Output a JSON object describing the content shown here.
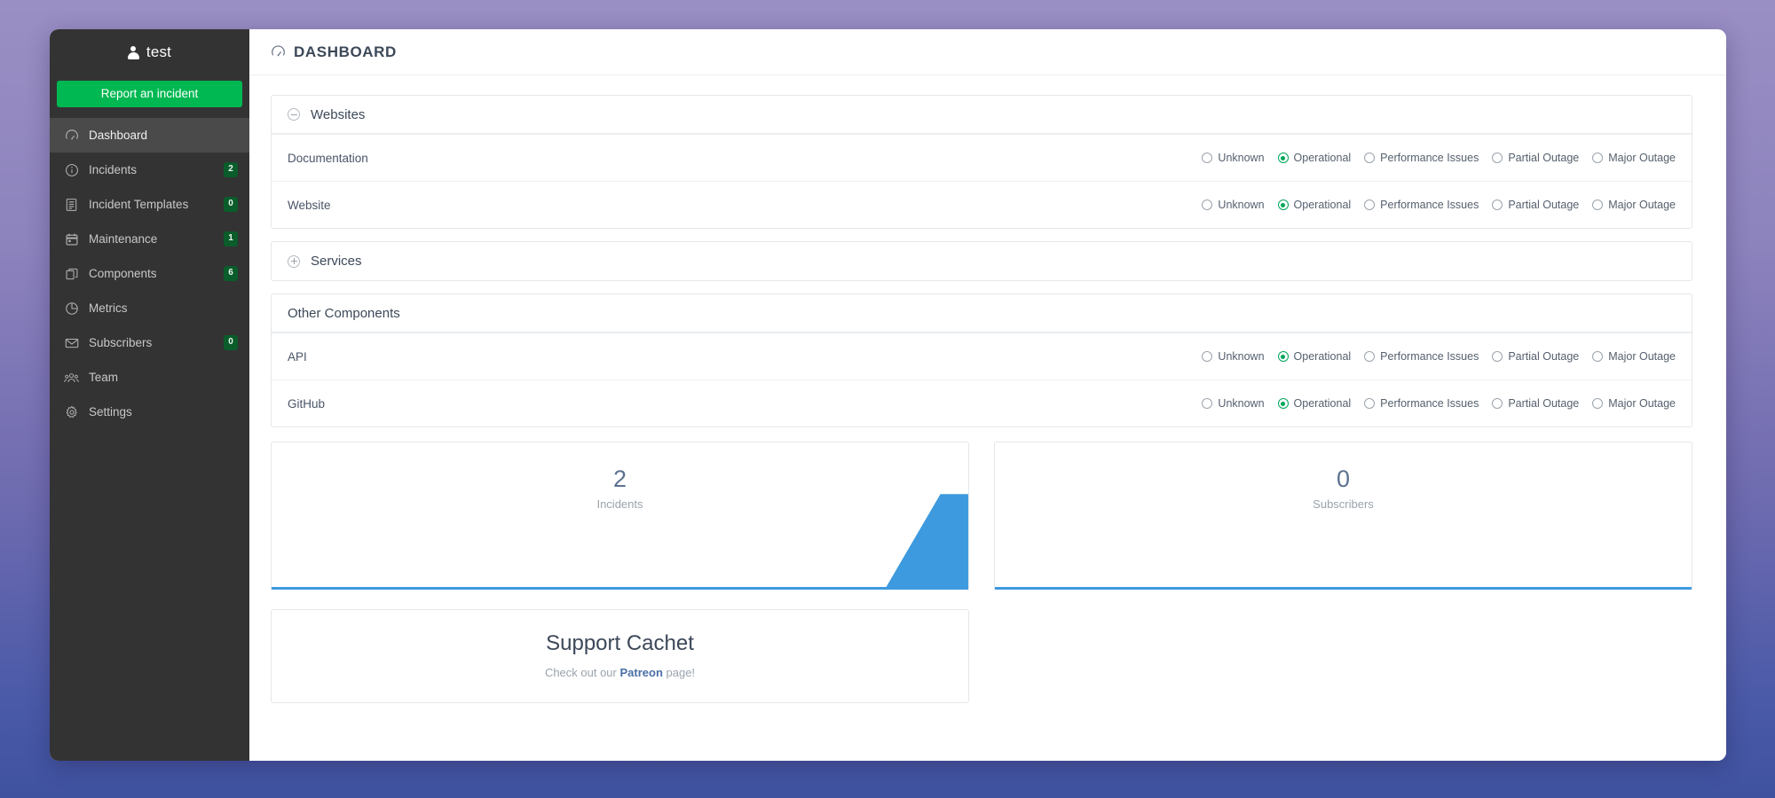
{
  "sidebar": {
    "brand": "test",
    "report_button": "Report an incident",
    "items": [
      {
        "label": "Dashboard",
        "icon": "dashboard-icon",
        "badge": null,
        "active": true
      },
      {
        "label": "Incidents",
        "icon": "info-circle-icon",
        "badge": "2",
        "active": false
      },
      {
        "label": "Incident Templates",
        "icon": "document-icon",
        "badge": "0",
        "active": false
      },
      {
        "label": "Maintenance",
        "icon": "calendar-icon",
        "badge": "1",
        "active": false
      },
      {
        "label": "Components",
        "icon": "copy-icon",
        "badge": "6",
        "active": false
      },
      {
        "label": "Metrics",
        "icon": "pie-chart-icon",
        "badge": null,
        "active": false
      },
      {
        "label": "Subscribers",
        "icon": "envelope-icon",
        "badge": "0",
        "active": false
      },
      {
        "label": "Team",
        "icon": "users-icon",
        "badge": null,
        "active": false
      },
      {
        "label": "Settings",
        "icon": "gear-icon",
        "badge": null,
        "active": false
      }
    ]
  },
  "topbar": {
    "icon": "dashboard-icon",
    "title": "DASHBOARD"
  },
  "status_options": [
    "Unknown",
    "Operational",
    "Performance Issues",
    "Partial Outage",
    "Major Outage"
  ],
  "groups": [
    {
      "name": "Websites",
      "toggle": "collapse",
      "collapsed": false,
      "components": [
        {
          "name": "Documentation",
          "status": "Operational"
        },
        {
          "name": "Website",
          "status": "Operational"
        }
      ]
    },
    {
      "name": "Services",
      "toggle": "expand",
      "collapsed": true,
      "components": []
    },
    {
      "name": "Other Components",
      "toggle": "none",
      "collapsed": false,
      "components": [
        {
          "name": "API",
          "status": "Operational"
        },
        {
          "name": "GitHub",
          "status": "Operational"
        }
      ]
    }
  ],
  "stats": [
    {
      "value": "2",
      "label": "Incidents",
      "accent": "#3e9ade",
      "spark": "spike-right"
    },
    {
      "value": "0",
      "label": "Subscribers",
      "accent": "#3e9ade",
      "spark": "flat"
    }
  ],
  "support": {
    "title": "Support Cachet",
    "text_before": "Check out our ",
    "link": "Patreon",
    "text_after": " page!"
  },
  "colors": {
    "sidebar_bg": "#333333",
    "sidebar_active": "#4a4a4a",
    "report_green": "#00b851",
    "badge_green": "#0a5c2a",
    "operational_green": "#00a65a",
    "chart_blue": "#3e9ade",
    "page_bg_top": "#9a8fc4",
    "page_bg_bottom": "#3f52a0"
  }
}
